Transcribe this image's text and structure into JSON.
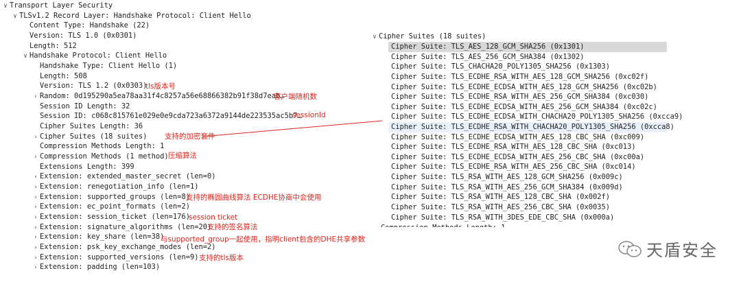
{
  "left_tree": [
    {
      "text": "Transport Layer Security",
      "toggle": "v"
    },
    {
      "text": "TLSv1.2 Record Layer: Handshake Protocol: Client Hello",
      "toggle": "v"
    },
    {
      "text": "Content Type: Handshake (22)",
      "toggle": ""
    },
    {
      "text": "Version: TLS 1.0 (0x0301)",
      "toggle": ""
    },
    {
      "text": "Length: 512",
      "toggle": ""
    },
    {
      "text": "Handshake Protocol: Client Hello",
      "toggle": "v"
    },
    {
      "text": "Handshake Type: Client Hello (1)",
      "toggle": ""
    },
    {
      "text": "Length: 508",
      "toggle": ""
    },
    {
      "text": "Version: TLS 1.2 (0x0303)",
      "toggle": ""
    },
    {
      "text": "Random: 0d195290a5ea78aa31f4c8257a56e68866382b91f38d7eab…",
      "toggle": ">"
    },
    {
      "text": "Session ID Length: 32",
      "toggle": ""
    },
    {
      "text": "Session ID: c068c815761e029e0e9cda723a6372a9144de223535ac5b7…",
      "toggle": ""
    },
    {
      "text": "Cipher Suites Length: 36",
      "toggle": ""
    },
    {
      "text": "Cipher Suites (18 suites)",
      "toggle": ">"
    },
    {
      "text": "Compression Methods Length: 1",
      "toggle": ""
    },
    {
      "text": "Compression Methods (1 method)",
      "toggle": ">"
    },
    {
      "text": "Extensions Length: 399",
      "toggle": ""
    },
    {
      "text": "Extension: extended_master_secret (len=0)",
      "toggle": ">"
    },
    {
      "text": "Extension: renegotiation_info (len=1)",
      "toggle": ">"
    },
    {
      "text": "Extension: supported_groups (len=8)",
      "toggle": ">"
    },
    {
      "text": "Extension: ec_point_formats (len=2)",
      "toggle": ">"
    },
    {
      "text": "Extension: session_ticket (len=176)",
      "toggle": ">"
    },
    {
      "text": "Extension: signature_algorithms (len=20)",
      "toggle": ">"
    },
    {
      "text": "Extension: key_share (len=38)",
      "toggle": ">"
    },
    {
      "text": "Extension: psk_key_exchange_modes (len=2)",
      "toggle": ">"
    },
    {
      "text": "Extension: supported_versions (len=9)",
      "toggle": ">"
    },
    {
      "text": "Extension: padding (len=103)",
      "toggle": ">"
    }
  ],
  "cipher_header": {
    "text": "Cipher Suites (18 suites)",
    "toggle": "v"
  },
  "cipher_suites": [
    "Cipher Suite: TLS_AES_128_GCM_SHA256 (0x1301)",
    "Cipher Suite: TLS_AES_256_GCM_SHA384 (0x1302)",
    "Cipher Suite: TLS_CHACHA20_POLY1305_SHA256 (0x1303)",
    "Cipher Suite: TLS_ECDHE_RSA_WITH_AES_128_GCM_SHA256 (0xc02f)",
    "Cipher Suite: TLS_ECDHE_ECDSA_WITH_AES_128_GCM_SHA256 (0xc02b)",
    "Cipher Suite: TLS_ECDHE_RSA_WITH_AES_256_GCM_SHA384 (0xc030)",
    "Cipher Suite: TLS_ECDHE_ECDSA_WITH_AES_256_GCM_SHA384 (0xc02c)",
    "Cipher Suite: TLS_ECDHE_ECDSA_WITH_CHACHA20_POLY1305_SHA256 (0xcca9)",
    "Cipher Suite: TLS_ECDHE_RSA_WITH_CHACHA20_POLY1305_SHA256 (0xcca8)",
    "Cipher Suite: TLS_ECDHE_ECDSA_WITH_AES_128_CBC_SHA (0xc009)",
    "Cipher Suite: TLS_ECDHE_RSA_WITH_AES_128_CBC_SHA (0xc013)",
    "Cipher Suite: TLS_ECDHE_ECDSA_WITH_AES_256_CBC_SHA (0xc00a)",
    "Cipher Suite: TLS_ECDHE_RSA_WITH_AES_256_CBC_SHA (0xc014)",
    "Cipher Suite: TLS_RSA_WITH_AES_128_GCM_SHA256 (0x009c)",
    "Cipher Suite: TLS_RSA_WITH_AES_256_GCM_SHA384 (0x009d)",
    "Cipher Suite: TLS_RSA_WITH_AES_128_CBC_SHA (0x002f)",
    "Cipher Suite: TLS_RSA_WITH_AES_256_CBC_SHA (0x0035)",
    "Cipher Suite: TLS_RSA_WITH_3DES_EDE_CBC_SHA (0x000a)"
  ],
  "cut_text": "Compression Methods Length: 1",
  "annotations": {
    "version": "tls版本号",
    "random": "客户端随机数",
    "session_id": "sessionId",
    "cipher_suites": "支持的加密套件",
    "compression": "压缩算法",
    "supported_groups": "支持的椭圆曲线算法 ECDHE协商中会使用",
    "session_ticket": "session ticket",
    "signature_algorithms": "支持的签名算法",
    "key_share": "与supported_group一起使用，指明client包含的DHE共享参数",
    "supported_versions": "支持的tls版本"
  },
  "watermark": {
    "text": "天盾安全",
    "icon": "wechat-icon"
  },
  "colors": {
    "annotation": "#e0241b",
    "selected_row": "#d9d9d9",
    "hover_row": "#e8f1fb"
  }
}
